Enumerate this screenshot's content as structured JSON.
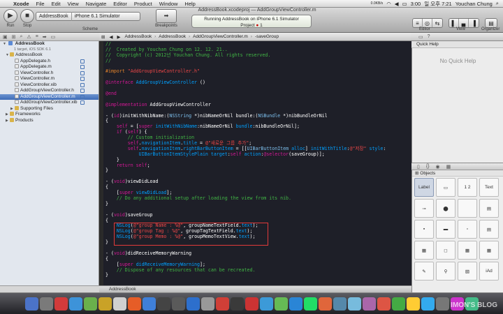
{
  "menubar": {
    "app_name": "Xcode",
    "items": [
      "File",
      "Edit",
      "View",
      "Navigate",
      "Editor",
      "Product",
      "Window",
      "Help"
    ],
    "status": {
      "datetime": "일 오후 7:21",
      "user": "Youchan Chung",
      "net": "0.0KB/s",
      "clock_small": "3:00"
    }
  },
  "toolbar": {
    "run_label": "Run",
    "stop_label": "Stop",
    "scheme_label": "Scheme",
    "scheme_target": "AddressBook",
    "scheme_destination": "iPhone 6.1 Simulator",
    "breakpoints_label": "Breakpoints",
    "editor_label": "Editor",
    "view_label": "View",
    "organizer_label": "Organizer"
  },
  "window": {
    "title": "AddressBook.xcodeproj — AddGroupViewController.m"
  },
  "activity": {
    "status": "Running AddressBook on iPhone 6.1 Simulator",
    "project_label": "Project",
    "error_count": "1"
  },
  "navigator": {
    "project_name": "AddressBook",
    "project_sub": "1 target, iOS SDK 6.1",
    "items": [
      {
        "label": "AddressBook",
        "indent": 1,
        "kind": "group"
      },
      {
        "label": "AppDelegate.h",
        "indent": 2,
        "kind": "h"
      },
      {
        "label": "AppDelegate.m",
        "indent": 2,
        "kind": "m"
      },
      {
        "label": "ViewController.h",
        "indent": 2,
        "kind": "h"
      },
      {
        "label": "ViewController.m",
        "indent": 2,
        "kind": "m"
      },
      {
        "label": "ViewController.xib",
        "indent": 2,
        "kind": "xib"
      },
      {
        "label": "AddGroupViewController.h",
        "indent": 2,
        "kind": "h"
      },
      {
        "label": "AddGroupViewController.m",
        "indent": 2,
        "kind": "m",
        "selected": true
      },
      {
        "label": "AddGroupViewController.xib",
        "indent": 2,
        "kind": "xib"
      },
      {
        "label": "Supporting Files",
        "indent": 2,
        "kind": "group"
      },
      {
        "label": "Frameworks",
        "indent": 1,
        "kind": "group"
      },
      {
        "label": "Products",
        "indent": 1,
        "kind": "group"
      }
    ]
  },
  "jumpbar": {
    "crumbs": [
      "AddressBook",
      "AddressBook",
      "AddGroupViewController.m",
      "-saveGroup"
    ]
  },
  "code": [
    [
      [
        "cm",
        "//"
      ]
    ],
    [
      [
        "cm",
        "//  Created by Youchan Chung on 12. 12. 21.."
      ]
    ],
    [
      [
        "cm",
        "//  Copyright (c) 2012년 Youchan Chung. All rights reserved."
      ]
    ],
    [
      [
        "cm",
        "//"
      ]
    ],
    [],
    [
      [
        "pp",
        "#import "
      ],
      [
        "st",
        "\"AddGroupViewController.h\""
      ]
    ],
    [],
    [
      [
        "kw",
        "@interface "
      ],
      [
        "",
        ""
      ],
      [
        "cl",
        "AddGroupViewController "
      ],
      [
        "",
        "()"
      ]
    ],
    [],
    [
      [
        "kw",
        "@end"
      ]
    ],
    [],
    [
      [
        "kw",
        "@implementation "
      ],
      [
        "",
        "AddGroupViewController"
      ]
    ],
    [],
    [
      [
        "",
        "- ("
      ],
      [
        "kw",
        "id"
      ],
      [
        "",
        ")initWithNibName:("
      ],
      [
        "ty",
        "NSString "
      ],
      [
        "",
        "*)nibNameOrNil bundle:("
      ],
      [
        "ty",
        "NSBundle "
      ],
      [
        "",
        "*)nibBundleOrNil"
      ]
    ],
    [
      [
        "",
        "{"
      ]
    ],
    [
      [
        "",
        "    "
      ],
      [
        "kw",
        "self "
      ],
      [
        "",
        "= ["
      ],
      [
        "kw",
        "super "
      ],
      [
        "mt",
        "initWithNibName"
      ],
      [
        "",
        ":nibNameOrNil "
      ],
      [
        "mt",
        "bundle"
      ],
      [
        "",
        ":nibBundleOrNil];"
      ]
    ],
    [
      [
        "",
        "    "
      ],
      [
        "kw",
        "if "
      ],
      [
        "",
        "("
      ],
      [
        "kw",
        "self"
      ],
      [
        "",
        ") {"
      ]
    ],
    [
      [
        "",
        "        "
      ],
      [
        "cm",
        "// Custom initialization"
      ]
    ],
    [
      [
        "",
        "        "
      ],
      [
        "kw",
        "self"
      ],
      [
        "",
        "."
      ],
      [
        "mt",
        "navigationItem"
      ],
      [
        "",
        "."
      ],
      [
        "mt",
        "title "
      ],
      [
        "",
        "= "
      ],
      [
        "st",
        "@\"새로운 그룹 추가\""
      ],
      [
        "",
        ";"
      ]
    ],
    [
      [
        "",
        "        "
      ],
      [
        "kw",
        "self"
      ],
      [
        "",
        "."
      ],
      [
        "mt",
        "navigationItem"
      ],
      [
        "",
        "."
      ],
      [
        "mt",
        "rightBarButtonItem "
      ],
      [
        "",
        "= [["
      ],
      [
        "ty",
        "UIBarButtonItem "
      ],
      [
        "mt",
        "alloc"
      ],
      [
        "",
        "] "
      ],
      [
        "mt",
        "initWithTitle"
      ],
      [
        "",
        ":"
      ],
      [
        "st",
        "@\"저장\""
      ],
      [
        "mt",
        " style"
      ],
      [
        "",
        ":"
      ]
    ],
    [
      [
        "",
        "            "
      ],
      [
        "mt",
        "UIBarButtonItemStylePlain "
      ],
      [
        "mt",
        "target"
      ],
      [
        "",
        ":"
      ],
      [
        "kw",
        "self "
      ],
      [
        "mt",
        "action"
      ],
      [
        "",
        ":"
      ],
      [
        "kw",
        "@selector"
      ],
      [
        "",
        "(saveGroup)];"
      ]
    ],
    [
      [
        "",
        "    }"
      ]
    ],
    [
      [
        "",
        "    "
      ],
      [
        "kw",
        "return self"
      ],
      [
        "",
        ";"
      ]
    ],
    [
      [
        "",
        "}"
      ]
    ],
    [],
    [
      [
        "",
        "- ("
      ],
      [
        "kw",
        "void"
      ],
      [
        "",
        ")viewDidLoad"
      ]
    ],
    [
      [
        "",
        "{"
      ]
    ],
    [
      [
        "",
        "    ["
      ],
      [
        "kw",
        "super "
      ],
      [
        "mt",
        "viewDidLoad"
      ],
      [
        "",
        "];"
      ]
    ],
    [
      [
        "",
        "    "
      ],
      [
        "cm",
        "// Do any additional setup after loading the view from its nib."
      ]
    ],
    [
      [
        "",
        "}"
      ]
    ],
    [],
    [
      [
        "",
        "- ("
      ],
      [
        "kw",
        "void"
      ],
      [
        "",
        ")saveGroup"
      ]
    ],
    [
      [
        "",
        "{"
      ]
    ],
    [
      [
        "",
        "    "
      ],
      [
        "mt",
        "NSLog"
      ],
      [
        "",
        "("
      ],
      [
        "st",
        "@\"group Name : %@\""
      ],
      [
        "",
        ", groupNameTextField."
      ],
      [
        "mt",
        "text"
      ],
      [
        "",
        ");"
      ]
    ],
    [
      [
        "",
        "    "
      ],
      [
        "mt",
        "NSLog"
      ],
      [
        "",
        "("
      ],
      [
        "st",
        "@\"group Tag : %@\""
      ],
      [
        "",
        ", groupTagTextField."
      ],
      [
        "mt",
        "text"
      ],
      [
        "",
        ");"
      ]
    ],
    [
      [
        "",
        "    "
      ],
      [
        "mt",
        "NSLog"
      ],
      [
        "",
        "("
      ],
      [
        "st",
        "@\"group Memo : %@\""
      ],
      [
        "",
        ", groupMemoTextView."
      ],
      [
        "mt",
        "text"
      ],
      [
        "",
        ");"
      ]
    ],
    [
      [
        "",
        "}"
      ]
    ],
    [],
    [
      [
        "",
        "- ("
      ],
      [
        "kw",
        "void"
      ],
      [
        "",
        ")didReceiveMemoryWarning"
      ]
    ],
    [
      [
        "",
        "{"
      ]
    ],
    [
      [
        "",
        "    ["
      ],
      [
        "kw",
        "super "
      ],
      [
        "mt",
        "didReceiveMemoryWarning"
      ],
      [
        "",
        "];"
      ]
    ],
    [
      [
        "",
        "    "
      ],
      [
        "cm",
        "// Dispose of any resources that can be recreated."
      ]
    ],
    [
      [
        "",
        "}"
      ]
    ]
  ],
  "debug_bar": {
    "label": "AddressBook"
  },
  "inspector": {
    "quick_help_title": "Quick Help",
    "no_help_text": "No Quick Help"
  },
  "library": {
    "selector_label": "Objects",
    "cells": [
      "Label",
      "",
      "1 2",
      "Text",
      "",
      "",
      "",
      "",
      "",
      "",
      "",
      "",
      "",
      "",
      "",
      "",
      "",
      "",
      "",
      "iAd"
    ]
  },
  "dock": {
    "watermark": "IMON'S BLOG"
  }
}
